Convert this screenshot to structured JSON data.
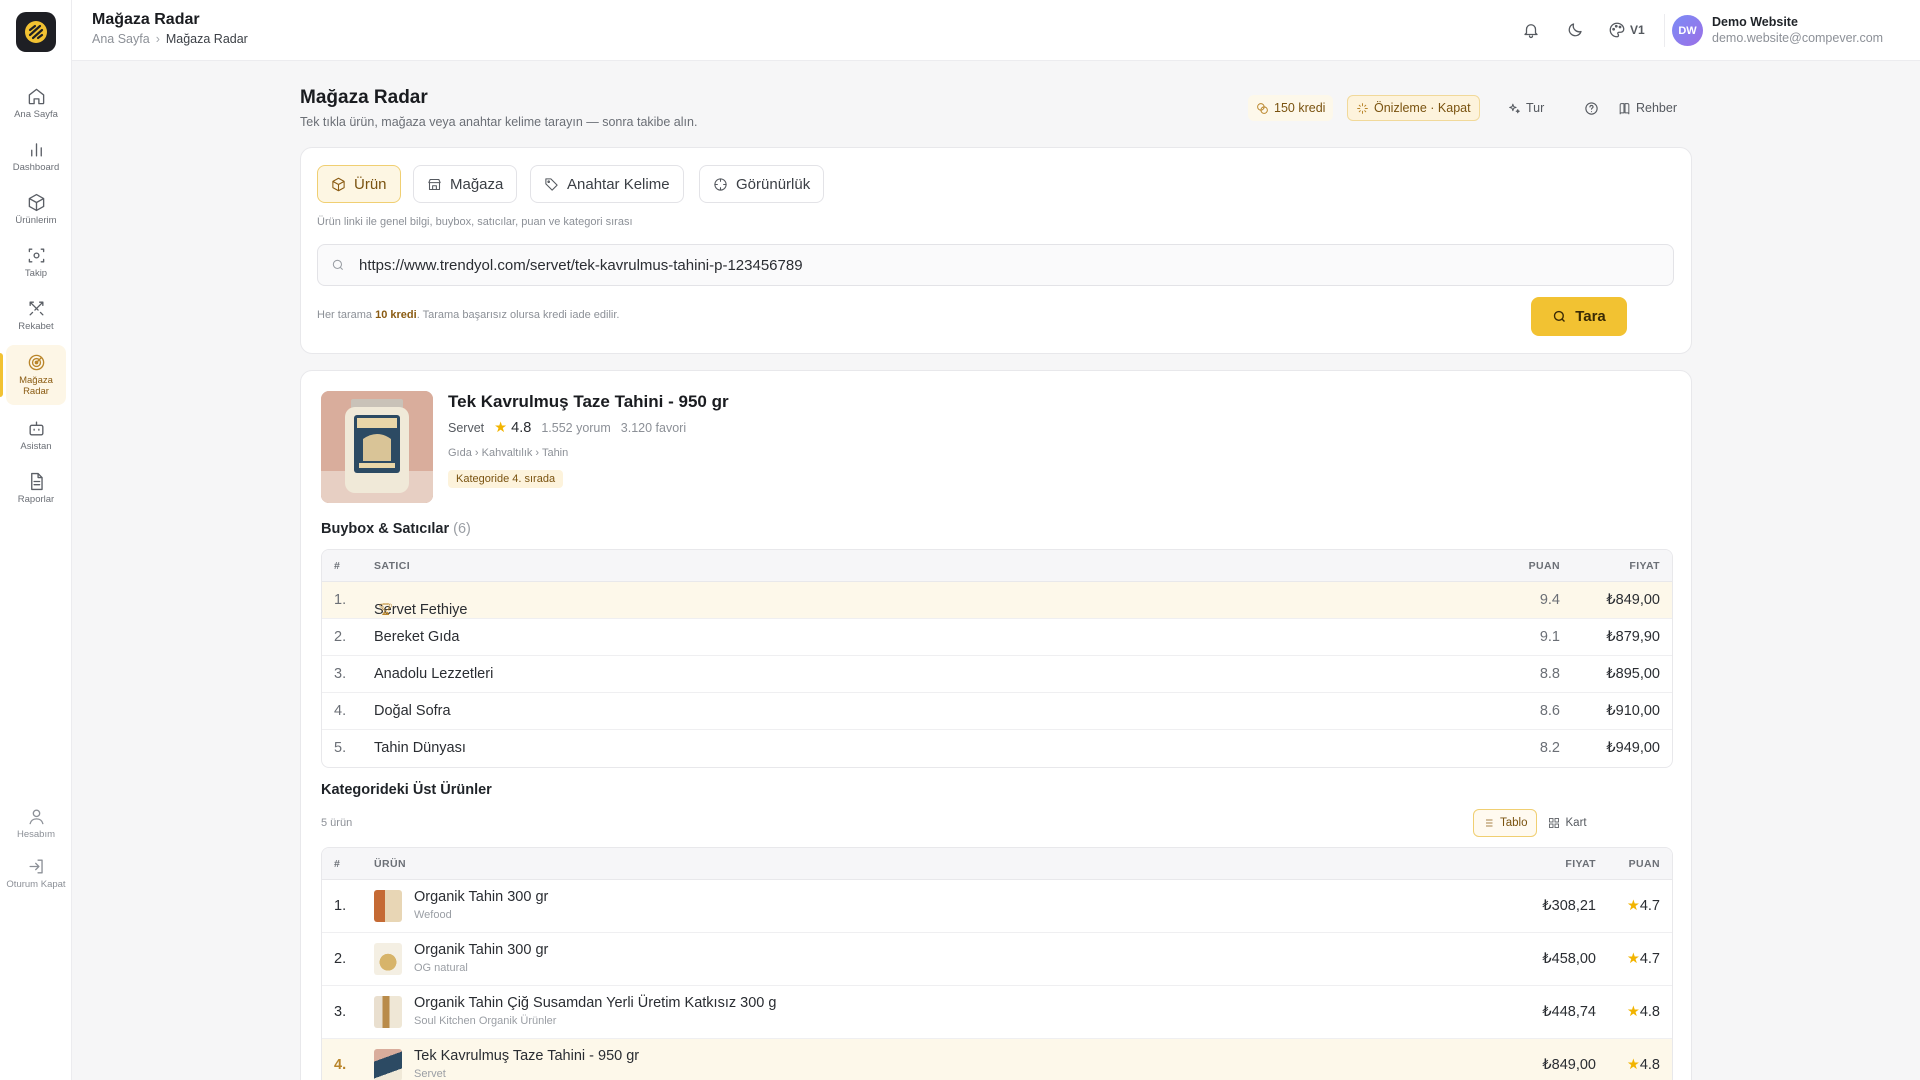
{
  "sidebar": {
    "items": [
      {
        "label": "Ana Sayfa",
        "icon": "home-icon"
      },
      {
        "label": "Dashboard",
        "icon": "bar-chart-icon"
      },
      {
        "label": "Ürünlerim",
        "icon": "box-icon"
      },
      {
        "label": "Takip",
        "icon": "scan-icon"
      },
      {
        "label": "Rekabet",
        "icon": "swords-icon"
      },
      {
        "label": "Mağaza Radar",
        "icon": "radar-icon"
      },
      {
        "label": "Asistan",
        "icon": "bot-icon"
      },
      {
        "label": "Raporlar",
        "icon": "file-icon"
      }
    ],
    "bottom": [
      {
        "label": "Hesabım",
        "icon": "user-icon"
      },
      {
        "label": "Oturum Kapat",
        "icon": "logout-icon"
      }
    ]
  },
  "topbar": {
    "title": "Mağaza Radar",
    "breadcrumb": {
      "home": "Ana Sayfa",
      "current": "Mağaza Radar"
    },
    "theme_label": "V1",
    "user": {
      "initials": "DW",
      "name": "Demo Website",
      "email": "demo.website@compever.com"
    }
  },
  "header": {
    "title": "Mağaza Radar",
    "subtitle": "Tek tıkla ürün, mağaza veya anahtar kelime tarayın — sonra takibe alın.",
    "credit": "150 kredi",
    "preview": "Önizleme · Kapat",
    "tour": "Tur",
    "guide": "Rehber"
  },
  "search": {
    "tabs": [
      "Ürün",
      "Mağaza",
      "Anahtar Kelime",
      "Görünürlük"
    ],
    "hint": "Ürün linki ile genel bilgi, buybox, satıcılar, puan ve kategori sırası",
    "url_value": "https://www.trendyol.com/servet/tek-kavrulmus-tahini-p-123456789",
    "cost_prefix": "Her tarama",
    "cost_amount": "10 kredi",
    "cost_suffix": ". Tarama başarısız olursa kredi iade edilir.",
    "scan_label": "Tara"
  },
  "product": {
    "title": "Tek Kavrulmuş Taze Tahini - 950 gr",
    "brand": "Servet",
    "rating": "4.8",
    "reviews": "1.552 yorum",
    "favorites": "3.120 favori",
    "path": "Gıda › Kahvaltılık › Tahin",
    "rank_badge": "Kategoride 4. sırada"
  },
  "buybox": {
    "title": "Buybox & Satıcılar",
    "count": "(6)",
    "columns": {
      "idx": "#",
      "seller": "SATICI",
      "score": "PUAN",
      "price": "FIYAT"
    },
    "rows": [
      {
        "idx": "1.",
        "seller": "Servet Fethiye",
        "score": "9.4",
        "price": "₺849,00"
      },
      {
        "idx": "2.",
        "seller": "Bereket Gıda",
        "score": "9.1",
        "price": "₺879,90"
      },
      {
        "idx": "3.",
        "seller": "Anadolu Lezzetleri",
        "score": "8.8",
        "price": "₺895,00"
      },
      {
        "idx": "4.",
        "seller": "Doğal Sofra",
        "score": "8.6",
        "price": "₺910,00"
      },
      {
        "idx": "5.",
        "seller": "Tahin Dünyası",
        "score": "8.2",
        "price": "₺949,00"
      }
    ]
  },
  "top_products": {
    "title": "Kategorideki Üst Ürünler",
    "count": "5 ürün",
    "view_table": "Tablo",
    "view_card": "Kart",
    "columns": {
      "idx": "#",
      "product": "ÜRÜN",
      "price": "FIYAT",
      "rating": "PUAN"
    },
    "rows": [
      {
        "idx": "1.",
        "name": "Organik Tahin 300 gr",
        "seller": "Wefood",
        "price": "₺308,21",
        "rating": "4.7"
      },
      {
        "idx": "2.",
        "name": "Organik Tahin 300 gr",
        "seller": "OG natural",
        "price": "₺458,00",
        "rating": "4.7"
      },
      {
        "idx": "3.",
        "name": "Organik Tahin Çiğ Susamdan Yerli Üretim Katkısız 300 g",
        "seller": "Soul Kitchen Organik Ürünler",
        "price": "₺448,74",
        "rating": "4.8"
      },
      {
        "idx": "4.",
        "name": "Tek Kavrulmuş Taze Tahini - 950 gr",
        "seller": "Servet",
        "price": "₺849,00",
        "rating": "4.8"
      }
    ]
  }
}
